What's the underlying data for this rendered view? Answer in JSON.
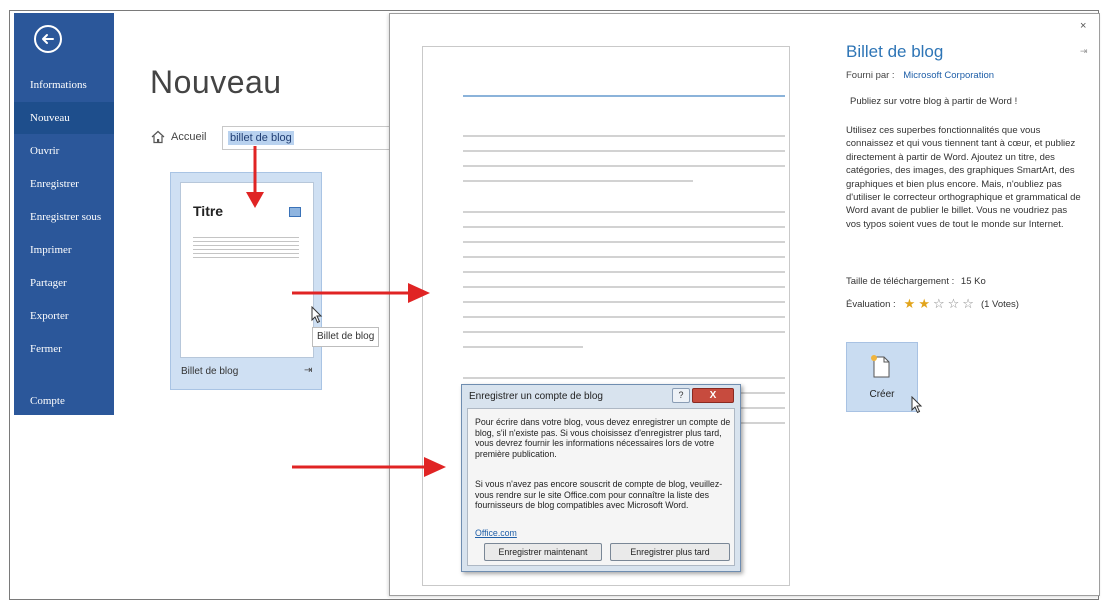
{
  "colors": {
    "sidebar_bg": "#2b579a",
    "sidebar_active": "#1e4e8c",
    "accent_blue": "#2e75b6",
    "arrow_red": "#e02424",
    "star_gold": "#e2a41b",
    "close_red": "#c74b3e"
  },
  "sidebar": {
    "back_icon": "back-arrow-icon",
    "items": [
      {
        "label": "Informations",
        "active": false
      },
      {
        "label": "Nouveau",
        "active": true
      },
      {
        "label": "Ouvrir",
        "active": false
      },
      {
        "label": "Enregistrer",
        "active": false
      },
      {
        "label": "Enregistrer sous",
        "active": false
      },
      {
        "label": "Imprimer",
        "active": false
      },
      {
        "label": "Partager",
        "active": false
      },
      {
        "label": "Exporter",
        "active": false
      },
      {
        "label": "Fermer",
        "active": false
      },
      {
        "label": "Compte",
        "active": false
      }
    ]
  },
  "main": {
    "title": "Nouveau",
    "home_label": "Accueil",
    "search_value": "billet de blog"
  },
  "template": {
    "thumb_title": "Titre",
    "label": "Billet de blog",
    "tooltip": "Billet de blog"
  },
  "preview": {
    "close": "×",
    "title": "Billet de blog",
    "provider_label": "Fourni par :",
    "provider_name": "Microsoft Corporation",
    "short_description": "Publiez sur votre blog à partir de Word !",
    "long_description": "Utilisez ces superbes fonctionnalités que vous connaissez et qui vous tiennent tant à cœur, et publiez directement à partir de Word. Ajoutez un titre, des catégories, des images, des graphiques SmartArt, des graphiques et bien plus encore. Mais, n'oubliez pas d'utiliser le correcteur orthographique et grammatical de Word avant de publier le billet. Vous ne voudriez pas vos typos soient vues de tout le monde sur Internet.",
    "download_size_label": "Taille de téléchargement :",
    "download_size_value": "15 Ko",
    "rating_label": "Évaluation :",
    "rating_stars": 2,
    "rating_max": 5,
    "votes": "(1 Votes)",
    "create_label": "Créer"
  },
  "modal": {
    "title": "Enregistrer un compte de blog",
    "help": "?",
    "close": "X",
    "paragraph1": "Pour écrire dans votre blog, vous devez enregistrer un compte de blog, s'il n'existe pas. Si vous choisissez d'enregistrer plus tard, vous devrez fournir les informations nécessaires lors de votre première publication.",
    "paragraph2": "Si vous n'avez pas encore souscrit de compte de blog, veuillez-vous rendre sur le site Office.com pour connaître la liste des fournisseurs de blog compatibles avec Microsoft Word.",
    "link": "Office.com",
    "btn_now": "Enregistrer maintenant",
    "btn_later": "Enregistrer plus tard"
  }
}
